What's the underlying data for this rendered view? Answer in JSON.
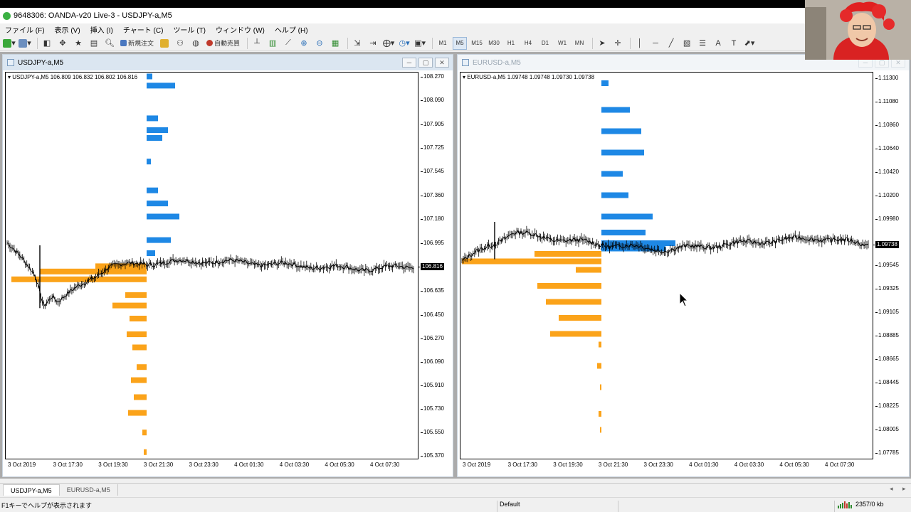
{
  "app": {
    "title": "9648306: OANDA-v20 Live-3 - USDJPY-a,M5"
  },
  "menu": [
    "ファイル (F)",
    "表示 (V)",
    "挿入 (I)",
    "チャート (C)",
    "ツール (T)",
    "ウィンドウ (W)",
    "ヘルプ (H)"
  ],
  "toolbar": {
    "new_order_label": "新規注文",
    "auto_trade_label": "自動売買",
    "timeframes": [
      "M1",
      "M5",
      "M15",
      "M30",
      "H1",
      "H4",
      "D1",
      "W1",
      "MN"
    ],
    "selected_timeframe": "M5"
  },
  "colors": {
    "volume_above": "#1e88e5",
    "volume_below": "#fba31a",
    "active_caption": "#dbe6f1",
    "mdi_background": "#ababab"
  },
  "windows": {
    "left": {
      "title": "USDJPY-a,M5",
      "ohlc": "USDJPY-a,M5  106.809 106.832 106.802 106.816",
      "current_price": "106.816",
      "y_labels": [
        "108.270",
        "108.090",
        "107.905",
        "107.725",
        "107.545",
        "107.360",
        "107.180",
        "106.995",
        "106.816",
        "106.635",
        "106.450",
        "106.270",
        "106.090",
        "105.910",
        "105.730",
        "105.550",
        "105.370"
      ],
      "x_labels": [
        "3 Oct 2019",
        "3 Oct 17:30",
        "3 Oct 19:30",
        "3 Oct 21:30",
        "3 Oct 23:30",
        "4 Oct 01:30",
        "4 Oct 03:30",
        "4 Oct 05:30",
        "4 Oct 07:30"
      ],
      "profile_marker": "%"
    },
    "right": {
      "title": "EURUSD-a,M5",
      "ohlc": "EURUSD-a,M5  1.09748 1.09748 1.09730 1.09738",
      "current_price": "1.09738",
      "y_labels": [
        "1.11300",
        "1.11080",
        "1.10860",
        "1.10640",
        "1.10420",
        "1.10200",
        "1.09980",
        "1.09738",
        "1.09545",
        "1.09325",
        "1.09105",
        "1.08885",
        "1.08665",
        "1.08445",
        "1.08225",
        "1.08005",
        "1.07785"
      ],
      "x_labels": [
        "3 Oct 2019",
        "3 Oct 17:30",
        "3 Oct 19:30",
        "3 Oct 21:30",
        "3 Oct 23:30",
        "4 Oct 01:30",
        "4 Oct 03:30",
        "4 Oct 05:30",
        "4 Oct 07:30"
      ],
      "profile_marker": "%"
    }
  },
  "chart_tabs": [
    "USDJPY-a,M5",
    "EURUSD-a,M5"
  ],
  "statusbar": {
    "help": "F1キーでヘルプが表示されます",
    "profile": "Default",
    "traffic": "2357/0 kb"
  },
  "chart_data": [
    {
      "type": "line",
      "title": "USDJPY-a,M5",
      "x": [
        "3 Oct 2019",
        "3 Oct 17:30",
        "3 Oct 19:30",
        "3 Oct 21:30",
        "3 Oct 23:30",
        "4 Oct 01:30",
        "4 Oct 03:30",
        "4 Oct 05:30",
        "4 Oct 07:30"
      ],
      "series": [
        {
          "values": [
            107.0,
            106.55,
            106.82,
            106.85,
            106.86,
            106.84,
            106.82,
            106.8,
            106.816
          ]
        }
      ],
      "ylim": [
        105.35,
        108.3
      ],
      "grid": false,
      "volume_profile": {
        "above": [
          [
            108.27,
            8
          ],
          [
            108.2,
            40
          ],
          [
            107.95,
            16
          ],
          [
            107.86,
            30
          ],
          [
            107.8,
            22
          ],
          [
            107.62,
            6
          ],
          [
            107.4,
            16
          ],
          [
            107.3,
            30
          ],
          [
            107.2,
            46
          ],
          [
            107.02,
            34
          ],
          [
            106.92,
            12
          ]
        ],
        "below": [
          [
            106.82,
            72
          ],
          [
            106.78,
            150
          ],
          [
            106.72,
            190
          ],
          [
            106.6,
            30
          ],
          [
            106.52,
            48
          ],
          [
            106.42,
            24
          ],
          [
            106.3,
            28
          ],
          [
            106.2,
            20
          ],
          [
            106.05,
            14
          ],
          [
            105.95,
            22
          ],
          [
            105.82,
            18
          ],
          [
            105.7,
            26
          ],
          [
            105.55,
            6
          ],
          [
            105.4,
            4
          ]
        ]
      }
    },
    {
      "type": "line",
      "title": "EURUSD-a,M5",
      "x": [
        "3 Oct 2019",
        "3 Oct 17:30",
        "3 Oct 19:30",
        "3 Oct 21:30",
        "3 Oct 23:30",
        "4 Oct 01:30",
        "4 Oct 03:30",
        "4 Oct 05:30",
        "4 Oct 07:30"
      ],
      "series": [
        {
          "values": [
            1.0958,
            1.0985,
            1.0978,
            1.0973,
            1.0969,
            1.0973,
            1.0977,
            1.098,
            1.09738
          ]
        }
      ],
      "ylim": [
        1.0773,
        1.1135
      ],
      "grid": false,
      "volume_profile": {
        "above": [
          [
            1.1125,
            10
          ],
          [
            1.11,
            40
          ],
          [
            1.108,
            56
          ],
          [
            1.106,
            60
          ],
          [
            1.104,
            30
          ],
          [
            1.102,
            38
          ],
          [
            1.1,
            72
          ],
          [
            1.0985,
            62
          ],
          [
            1.0975,
            104
          ],
          [
            1.097,
            90
          ]
        ],
        "below": [
          [
            1.0965,
            94
          ],
          [
            1.0958,
            196
          ],
          [
            1.095,
            36
          ],
          [
            1.0935,
            90
          ],
          [
            1.092,
            78
          ],
          [
            1.0905,
            60
          ],
          [
            1.089,
            72
          ],
          [
            1.088,
            4
          ],
          [
            1.086,
            6
          ],
          [
            1.084,
            2
          ],
          [
            1.0815,
            4
          ],
          [
            1.08,
            2
          ]
        ]
      }
    }
  ]
}
